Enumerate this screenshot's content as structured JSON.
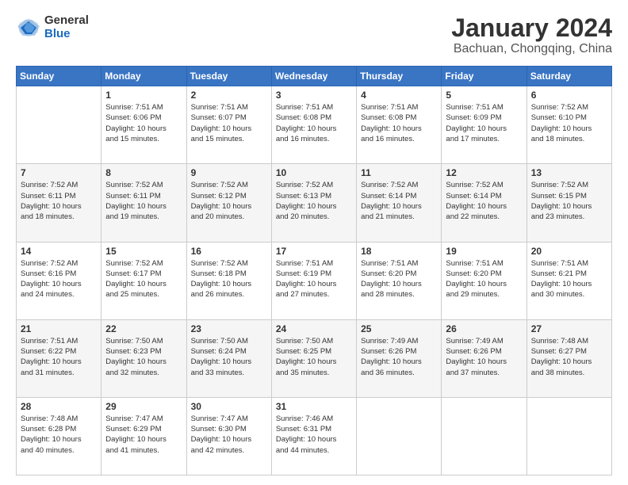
{
  "header": {
    "logo": {
      "general": "General",
      "blue": "Blue"
    },
    "title": "January 2024",
    "subtitle": "Bachuan, Chongqing, China"
  },
  "days_of_week": [
    "Sunday",
    "Monday",
    "Tuesday",
    "Wednesday",
    "Thursday",
    "Friday",
    "Saturday"
  ],
  "weeks": [
    [
      {
        "day": "",
        "info": ""
      },
      {
        "day": "1",
        "info": "Sunrise: 7:51 AM\nSunset: 6:06 PM\nDaylight: 10 hours\nand 15 minutes."
      },
      {
        "day": "2",
        "info": "Sunrise: 7:51 AM\nSunset: 6:07 PM\nDaylight: 10 hours\nand 15 minutes."
      },
      {
        "day": "3",
        "info": "Sunrise: 7:51 AM\nSunset: 6:08 PM\nDaylight: 10 hours\nand 16 minutes."
      },
      {
        "day": "4",
        "info": "Sunrise: 7:51 AM\nSunset: 6:08 PM\nDaylight: 10 hours\nand 16 minutes."
      },
      {
        "day": "5",
        "info": "Sunrise: 7:51 AM\nSunset: 6:09 PM\nDaylight: 10 hours\nand 17 minutes."
      },
      {
        "day": "6",
        "info": "Sunrise: 7:52 AM\nSunset: 6:10 PM\nDaylight: 10 hours\nand 18 minutes."
      }
    ],
    [
      {
        "day": "7",
        "info": "Sunrise: 7:52 AM\nSunset: 6:11 PM\nDaylight: 10 hours\nand 18 minutes."
      },
      {
        "day": "8",
        "info": "Sunrise: 7:52 AM\nSunset: 6:11 PM\nDaylight: 10 hours\nand 19 minutes."
      },
      {
        "day": "9",
        "info": "Sunrise: 7:52 AM\nSunset: 6:12 PM\nDaylight: 10 hours\nand 20 minutes."
      },
      {
        "day": "10",
        "info": "Sunrise: 7:52 AM\nSunset: 6:13 PM\nDaylight: 10 hours\nand 20 minutes."
      },
      {
        "day": "11",
        "info": "Sunrise: 7:52 AM\nSunset: 6:14 PM\nDaylight: 10 hours\nand 21 minutes."
      },
      {
        "day": "12",
        "info": "Sunrise: 7:52 AM\nSunset: 6:14 PM\nDaylight: 10 hours\nand 22 minutes."
      },
      {
        "day": "13",
        "info": "Sunrise: 7:52 AM\nSunset: 6:15 PM\nDaylight: 10 hours\nand 23 minutes."
      }
    ],
    [
      {
        "day": "14",
        "info": "Sunrise: 7:52 AM\nSunset: 6:16 PM\nDaylight: 10 hours\nand 24 minutes."
      },
      {
        "day": "15",
        "info": "Sunrise: 7:52 AM\nSunset: 6:17 PM\nDaylight: 10 hours\nand 25 minutes."
      },
      {
        "day": "16",
        "info": "Sunrise: 7:52 AM\nSunset: 6:18 PM\nDaylight: 10 hours\nand 26 minutes."
      },
      {
        "day": "17",
        "info": "Sunrise: 7:51 AM\nSunset: 6:19 PM\nDaylight: 10 hours\nand 27 minutes."
      },
      {
        "day": "18",
        "info": "Sunrise: 7:51 AM\nSunset: 6:20 PM\nDaylight: 10 hours\nand 28 minutes."
      },
      {
        "day": "19",
        "info": "Sunrise: 7:51 AM\nSunset: 6:20 PM\nDaylight: 10 hours\nand 29 minutes."
      },
      {
        "day": "20",
        "info": "Sunrise: 7:51 AM\nSunset: 6:21 PM\nDaylight: 10 hours\nand 30 minutes."
      }
    ],
    [
      {
        "day": "21",
        "info": "Sunrise: 7:51 AM\nSunset: 6:22 PM\nDaylight: 10 hours\nand 31 minutes."
      },
      {
        "day": "22",
        "info": "Sunrise: 7:50 AM\nSunset: 6:23 PM\nDaylight: 10 hours\nand 32 minutes."
      },
      {
        "day": "23",
        "info": "Sunrise: 7:50 AM\nSunset: 6:24 PM\nDaylight: 10 hours\nand 33 minutes."
      },
      {
        "day": "24",
        "info": "Sunrise: 7:50 AM\nSunset: 6:25 PM\nDaylight: 10 hours\nand 35 minutes."
      },
      {
        "day": "25",
        "info": "Sunrise: 7:49 AM\nSunset: 6:26 PM\nDaylight: 10 hours\nand 36 minutes."
      },
      {
        "day": "26",
        "info": "Sunrise: 7:49 AM\nSunset: 6:26 PM\nDaylight: 10 hours\nand 37 minutes."
      },
      {
        "day": "27",
        "info": "Sunrise: 7:48 AM\nSunset: 6:27 PM\nDaylight: 10 hours\nand 38 minutes."
      }
    ],
    [
      {
        "day": "28",
        "info": "Sunrise: 7:48 AM\nSunset: 6:28 PM\nDaylight: 10 hours\nand 40 minutes."
      },
      {
        "day": "29",
        "info": "Sunrise: 7:47 AM\nSunset: 6:29 PM\nDaylight: 10 hours\nand 41 minutes."
      },
      {
        "day": "30",
        "info": "Sunrise: 7:47 AM\nSunset: 6:30 PM\nDaylight: 10 hours\nand 42 minutes."
      },
      {
        "day": "31",
        "info": "Sunrise: 7:46 AM\nSunset: 6:31 PM\nDaylight: 10 hours\nand 44 minutes."
      },
      {
        "day": "",
        "info": ""
      },
      {
        "day": "",
        "info": ""
      },
      {
        "day": "",
        "info": ""
      }
    ]
  ]
}
